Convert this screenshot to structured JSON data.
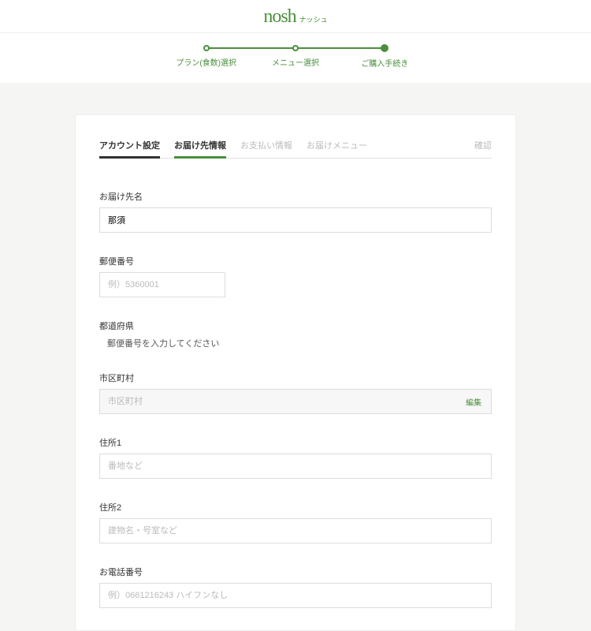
{
  "logo": {
    "main": "nosh",
    "sub": "ナッシュ"
  },
  "stepper": {
    "steps": [
      {
        "label": "プラン(食数)選択"
      },
      {
        "label": "メニュー選択"
      },
      {
        "label": "ご購入手続き"
      }
    ]
  },
  "tabs": {
    "account": "アカウント設定",
    "delivery": "お届け先情報",
    "payment": "お支払い情報",
    "menu": "お届けメニュー",
    "confirm": "確認"
  },
  "fields": {
    "name": {
      "label": "お届け先名",
      "value": "那須"
    },
    "postal": {
      "label": "郵便番号",
      "placeholder": "例）5360001"
    },
    "prefecture": {
      "label": "都道府県",
      "note": "郵便番号を入力してください"
    },
    "city": {
      "label": "市区町村",
      "placeholder": "市区町村",
      "edit": "編集"
    },
    "addr1": {
      "label": "住所1",
      "placeholder": "番地など"
    },
    "addr2": {
      "label": "住所2",
      "placeholder": "建物名・号室など"
    },
    "phone": {
      "label": "お電話番号",
      "placeholder": "例）0661216243 ハイフンなし"
    }
  }
}
